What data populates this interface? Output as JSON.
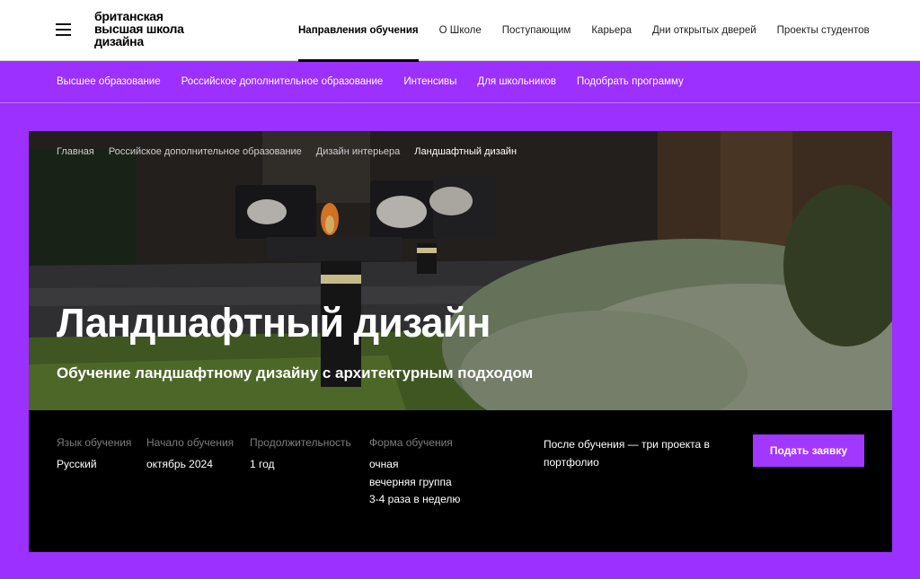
{
  "header": {
    "logo_lines": [
      "британская",
      "высшая школа",
      "дизайна"
    ],
    "nav": [
      {
        "label": "Направления обучения",
        "active": true
      },
      {
        "label": "О Школе"
      },
      {
        "label": "Поступающим"
      },
      {
        "label": "Карьера"
      },
      {
        "label": "Дни открытых дверей"
      },
      {
        "label": "Проекты студентов"
      }
    ]
  },
  "subnav": [
    "Высшее образование",
    "Российское дополнительное образование",
    "Интенсивы",
    "Для школьников",
    "Подобрать программу"
  ],
  "breadcrumbs": [
    "Главная",
    "Российское дополнительное образование",
    "Дизайн интерьера",
    "Ландшафтный дизайн"
  ],
  "hero": {
    "title": "Ландшафтный дизайн",
    "subtitle": "Обучение ландшафтному дизайну с архитектурным подходом"
  },
  "details": {
    "language": {
      "label": "Язык обучения",
      "value": "Русский"
    },
    "start": {
      "label": "Начало обучения",
      "value": "октябрь 2024"
    },
    "duration": {
      "label": "Продолжительность",
      "value": "1 год"
    },
    "format": {
      "label": "Форма обучения",
      "values": [
        "очная",
        "вечерняя группа",
        "3-4 раза в неделю"
      ]
    },
    "after": "После обучения — три проекта в портфолио",
    "apply_label": "Подать заявку"
  },
  "colors": {
    "accent": "#9b30ff",
    "button": "#a238ff",
    "panel": "#000000"
  }
}
